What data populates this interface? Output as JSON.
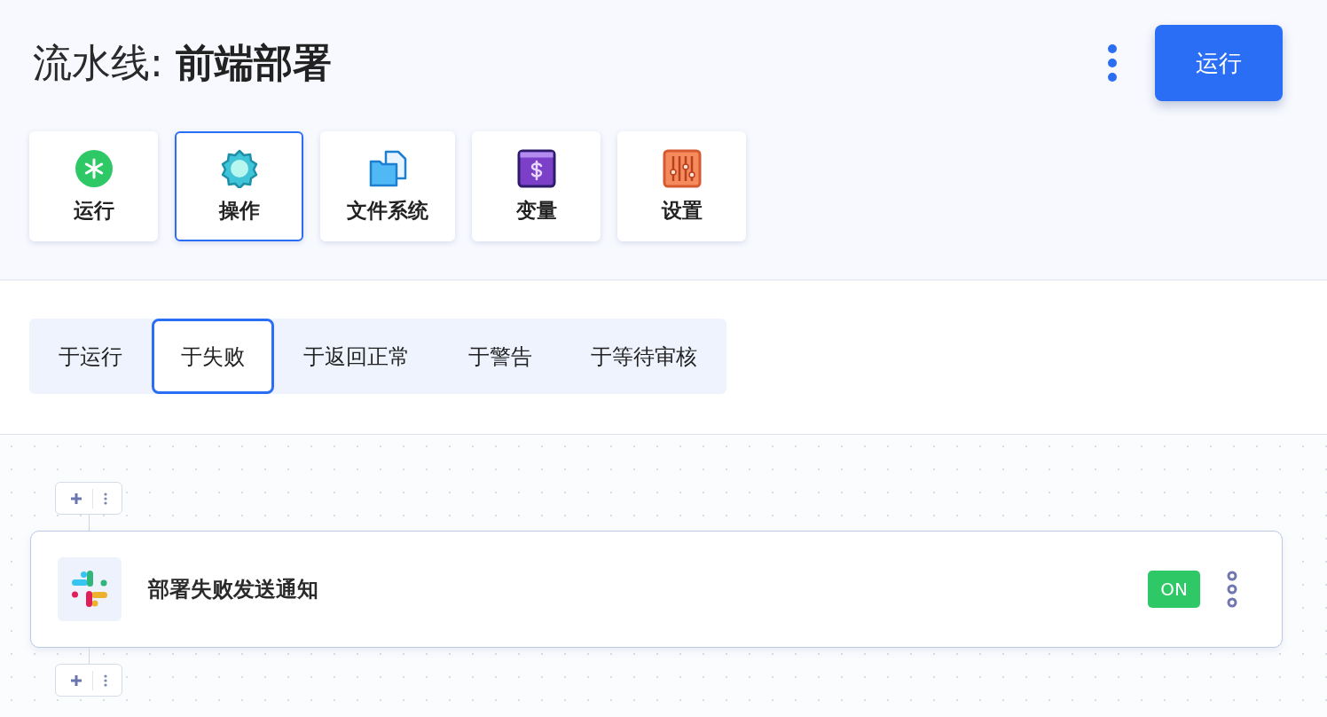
{
  "header": {
    "title": "流水线: **前端部署**",
    "run_button": "运行"
  },
  "categories": [
    {
      "label": "运行",
      "selected": false
    },
    {
      "label": "操作",
      "selected": true
    },
    {
      "label": "文件系统",
      "selected": false
    },
    {
      "label": "变量",
      "selected": false
    },
    {
      "label": "设置",
      "selected": false
    }
  ],
  "tabs": [
    {
      "label": "于运行",
      "selected": false
    },
    {
      "label": "于失败",
      "selected": true
    },
    {
      "label": "于返回正常",
      "selected": false
    },
    {
      "label": "于警告",
      "selected": false
    },
    {
      "label": "于等待审核",
      "selected": false
    }
  ],
  "steps": [
    {
      "title": "部署失败发送通知",
      "toggle": "ON",
      "on": true
    }
  ]
}
